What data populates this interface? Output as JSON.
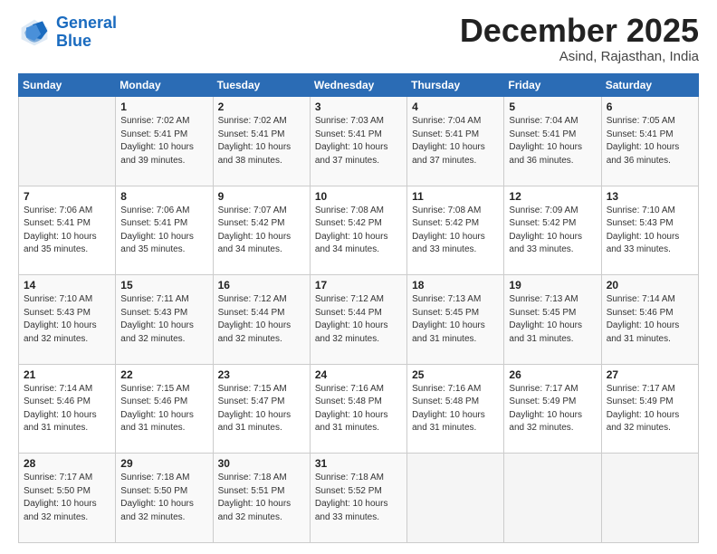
{
  "logo": {
    "line1": "General",
    "line2": "Blue"
  },
  "header": {
    "title": "December 2025",
    "subtitle": "Asind, Rajasthan, India"
  },
  "days_of_week": [
    "Sunday",
    "Monday",
    "Tuesday",
    "Wednesday",
    "Thursday",
    "Friday",
    "Saturday"
  ],
  "weeks": [
    [
      {
        "day": "",
        "info": ""
      },
      {
        "day": "1",
        "info": "Sunrise: 7:02 AM\nSunset: 5:41 PM\nDaylight: 10 hours\nand 39 minutes."
      },
      {
        "day": "2",
        "info": "Sunrise: 7:02 AM\nSunset: 5:41 PM\nDaylight: 10 hours\nand 38 minutes."
      },
      {
        "day": "3",
        "info": "Sunrise: 7:03 AM\nSunset: 5:41 PM\nDaylight: 10 hours\nand 37 minutes."
      },
      {
        "day": "4",
        "info": "Sunrise: 7:04 AM\nSunset: 5:41 PM\nDaylight: 10 hours\nand 37 minutes."
      },
      {
        "day": "5",
        "info": "Sunrise: 7:04 AM\nSunset: 5:41 PM\nDaylight: 10 hours\nand 36 minutes."
      },
      {
        "day": "6",
        "info": "Sunrise: 7:05 AM\nSunset: 5:41 PM\nDaylight: 10 hours\nand 36 minutes."
      }
    ],
    [
      {
        "day": "7",
        "info": "Sunrise: 7:06 AM\nSunset: 5:41 PM\nDaylight: 10 hours\nand 35 minutes."
      },
      {
        "day": "8",
        "info": "Sunrise: 7:06 AM\nSunset: 5:41 PM\nDaylight: 10 hours\nand 35 minutes."
      },
      {
        "day": "9",
        "info": "Sunrise: 7:07 AM\nSunset: 5:42 PM\nDaylight: 10 hours\nand 34 minutes."
      },
      {
        "day": "10",
        "info": "Sunrise: 7:08 AM\nSunset: 5:42 PM\nDaylight: 10 hours\nand 34 minutes."
      },
      {
        "day": "11",
        "info": "Sunrise: 7:08 AM\nSunset: 5:42 PM\nDaylight: 10 hours\nand 33 minutes."
      },
      {
        "day": "12",
        "info": "Sunrise: 7:09 AM\nSunset: 5:42 PM\nDaylight: 10 hours\nand 33 minutes."
      },
      {
        "day": "13",
        "info": "Sunrise: 7:10 AM\nSunset: 5:43 PM\nDaylight: 10 hours\nand 33 minutes."
      }
    ],
    [
      {
        "day": "14",
        "info": "Sunrise: 7:10 AM\nSunset: 5:43 PM\nDaylight: 10 hours\nand 32 minutes."
      },
      {
        "day": "15",
        "info": "Sunrise: 7:11 AM\nSunset: 5:43 PM\nDaylight: 10 hours\nand 32 minutes."
      },
      {
        "day": "16",
        "info": "Sunrise: 7:12 AM\nSunset: 5:44 PM\nDaylight: 10 hours\nand 32 minutes."
      },
      {
        "day": "17",
        "info": "Sunrise: 7:12 AM\nSunset: 5:44 PM\nDaylight: 10 hours\nand 32 minutes."
      },
      {
        "day": "18",
        "info": "Sunrise: 7:13 AM\nSunset: 5:45 PM\nDaylight: 10 hours\nand 31 minutes."
      },
      {
        "day": "19",
        "info": "Sunrise: 7:13 AM\nSunset: 5:45 PM\nDaylight: 10 hours\nand 31 minutes."
      },
      {
        "day": "20",
        "info": "Sunrise: 7:14 AM\nSunset: 5:46 PM\nDaylight: 10 hours\nand 31 minutes."
      }
    ],
    [
      {
        "day": "21",
        "info": "Sunrise: 7:14 AM\nSunset: 5:46 PM\nDaylight: 10 hours\nand 31 minutes."
      },
      {
        "day": "22",
        "info": "Sunrise: 7:15 AM\nSunset: 5:46 PM\nDaylight: 10 hours\nand 31 minutes."
      },
      {
        "day": "23",
        "info": "Sunrise: 7:15 AM\nSunset: 5:47 PM\nDaylight: 10 hours\nand 31 minutes."
      },
      {
        "day": "24",
        "info": "Sunrise: 7:16 AM\nSunset: 5:48 PM\nDaylight: 10 hours\nand 31 minutes."
      },
      {
        "day": "25",
        "info": "Sunrise: 7:16 AM\nSunset: 5:48 PM\nDaylight: 10 hours\nand 31 minutes."
      },
      {
        "day": "26",
        "info": "Sunrise: 7:17 AM\nSunset: 5:49 PM\nDaylight: 10 hours\nand 32 minutes."
      },
      {
        "day": "27",
        "info": "Sunrise: 7:17 AM\nSunset: 5:49 PM\nDaylight: 10 hours\nand 32 minutes."
      }
    ],
    [
      {
        "day": "28",
        "info": "Sunrise: 7:17 AM\nSunset: 5:50 PM\nDaylight: 10 hours\nand 32 minutes."
      },
      {
        "day": "29",
        "info": "Sunrise: 7:18 AM\nSunset: 5:50 PM\nDaylight: 10 hours\nand 32 minutes."
      },
      {
        "day": "30",
        "info": "Sunrise: 7:18 AM\nSunset: 5:51 PM\nDaylight: 10 hours\nand 32 minutes."
      },
      {
        "day": "31",
        "info": "Sunrise: 7:18 AM\nSunset: 5:52 PM\nDaylight: 10 hours\nand 33 minutes."
      },
      {
        "day": "",
        "info": ""
      },
      {
        "day": "",
        "info": ""
      },
      {
        "day": "",
        "info": ""
      }
    ]
  ]
}
